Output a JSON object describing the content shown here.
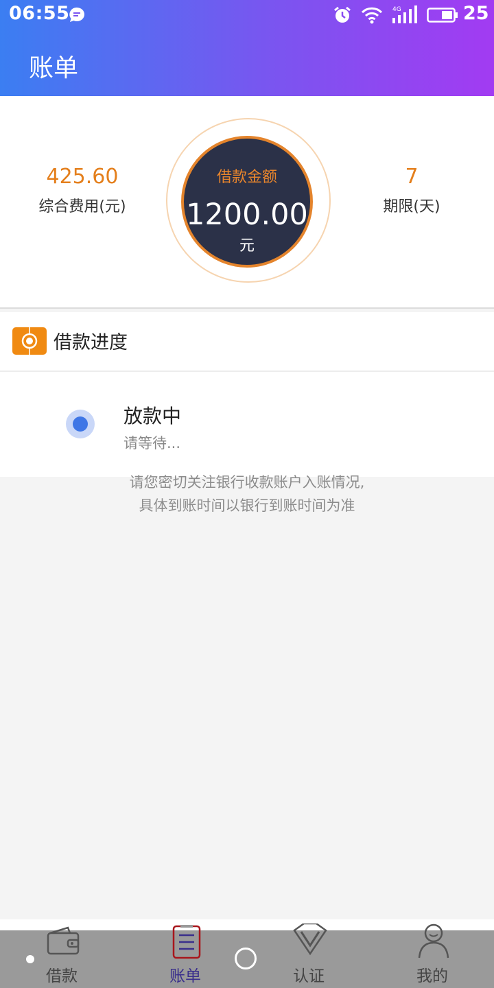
{
  "status_bar": {
    "time": "06:55",
    "network": "4G",
    "battery": "25"
  },
  "header": {
    "title": "账单"
  },
  "summary": {
    "fee_value": "425.60",
    "fee_label": "综合费用(元)",
    "amount_caption": "借款金额",
    "amount_value": "1200.00",
    "amount_unit": "元",
    "term_value": "7",
    "term_label": "期限(天)"
  },
  "progress": {
    "title": "借款进度",
    "step_title": "放款中",
    "step_subtitle": "请等待...",
    "notice_line1": "请您密切关注银行收款账户入账情况,",
    "notice_line2": "具体到账时间以银行到账时间为准"
  },
  "tabbar": {
    "items": [
      {
        "label": "借款",
        "icon": "wallet-icon"
      },
      {
        "label": "账单",
        "icon": "bill-icon",
        "active": true
      },
      {
        "label": "认证",
        "icon": "verify-icon"
      },
      {
        "label": "我的",
        "icon": "person-icon"
      }
    ]
  },
  "colors": {
    "accent": "#e47f1c",
    "header_start": "#3b7ef2",
    "header_end": "#a23bf2",
    "ring_dark": "#2b3148",
    "active_tab": "#3a2f8c"
  }
}
